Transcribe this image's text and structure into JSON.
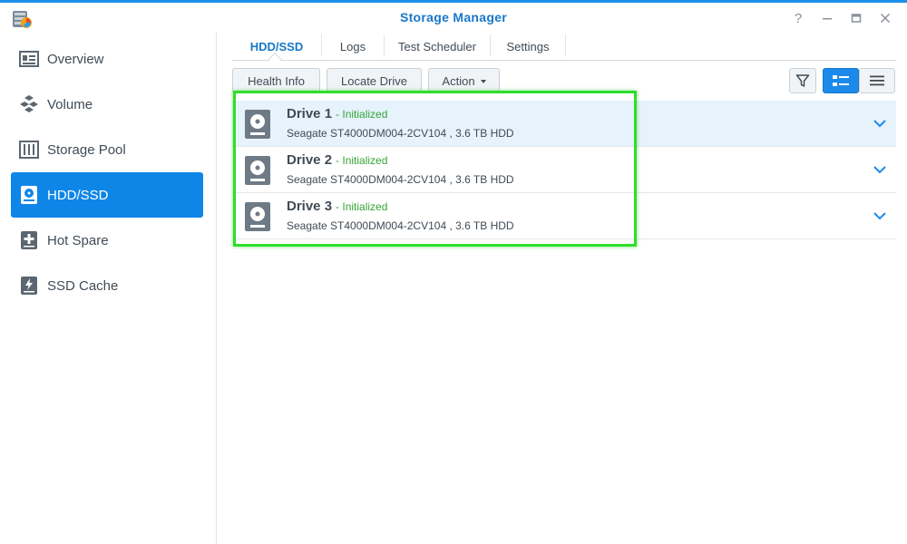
{
  "window": {
    "title": "Storage Manager",
    "controls": [
      "help-icon",
      "minimize-icon",
      "maximize-icon",
      "close-icon"
    ]
  },
  "sidebar": {
    "items": [
      {
        "label": "Overview",
        "icon": "overview-icon",
        "active": false
      },
      {
        "label": "Volume",
        "icon": "volume-icon",
        "active": false
      },
      {
        "label": "Storage Pool",
        "icon": "storage-pool-icon",
        "active": false
      },
      {
        "label": "HDD/SSD",
        "icon": "hdd-icon",
        "active": true
      },
      {
        "label": "Hot Spare",
        "icon": "hot-spare-icon",
        "active": false
      },
      {
        "label": "SSD Cache",
        "icon": "ssd-cache-icon",
        "active": false
      }
    ]
  },
  "tabs": [
    {
      "label": "HDD/SSD",
      "active": true
    },
    {
      "label": "Logs",
      "active": false
    },
    {
      "label": "Test Scheduler",
      "active": false
    },
    {
      "label": "Settings",
      "active": false
    }
  ],
  "toolbar": {
    "health_info": "Health Info",
    "locate_drive": "Locate Drive",
    "action": "Action"
  },
  "view_controls": [
    "filter-icon",
    "list-detail-view-icon",
    "list-compact-view-icon"
  ],
  "drives": [
    {
      "name": "Drive 1",
      "status": "- Initialized",
      "description": "Seagate ST4000DM004-2CV104 , 3.6 TB HDD",
      "selected": true
    },
    {
      "name": "Drive 2",
      "status": "- Initialized",
      "description": "Seagate ST4000DM004-2CV104 , 3.6 TB HDD",
      "selected": false
    },
    {
      "name": "Drive 3",
      "status": "- Initialized",
      "description": "Seagate ST4000DM004-2CV104 , 3.6 TB HDD",
      "selected": false
    }
  ],
  "colors": {
    "accent": "#0e86e8",
    "title": "#1877c9",
    "status_ok": "#36a437",
    "highlight": "#2fde2b"
  }
}
